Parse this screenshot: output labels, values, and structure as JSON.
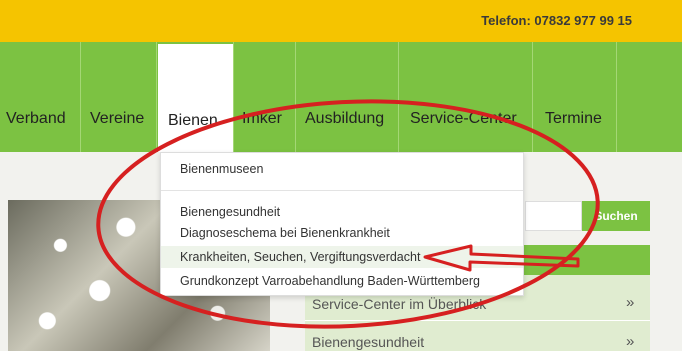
{
  "topbar": {
    "phone": "Telefon: 07832 977 99 15"
  },
  "nav": {
    "items": [
      {
        "label": "Verband"
      },
      {
        "label": "Vereine"
      },
      {
        "label": "Bienen"
      },
      {
        "label": "Imker"
      },
      {
        "label": "Ausbildung"
      },
      {
        "label": "Service-Center"
      },
      {
        "label": "Termine"
      }
    ]
  },
  "dropdown": {
    "items": [
      {
        "label": "Bienenmuseen"
      },
      {
        "label": "Bienengesundheit"
      },
      {
        "label": "Diagnoseschema bei Bienenkrankheit"
      },
      {
        "label": "Krankheiten, Seuchen, Vergiftungsverdacht"
      },
      {
        "label": "Grundkonzept Varroabehandlung Baden-Württemberg"
      }
    ]
  },
  "search": {
    "button_label": "Suchen"
  },
  "sidebar": {
    "items": [
      {
        "label": "Service-Center im Überblick",
        "arrow": "»"
      },
      {
        "label": "Bienengesundheit",
        "arrow": "»"
      }
    ]
  },
  "annotation": {
    "color": "#d62020"
  }
}
